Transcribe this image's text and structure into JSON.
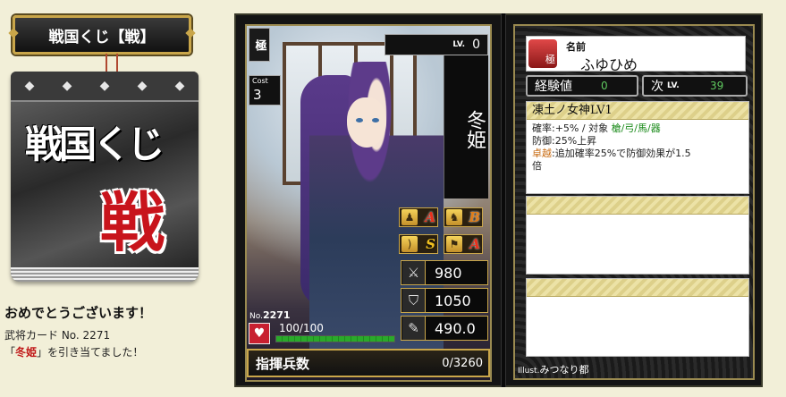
{
  "header": {
    "title": "戦国くじ【戦】"
  },
  "ticket": {
    "line1": "戦国くじ",
    "line2": "戦",
    "top_marks": [
      "◆",
      "◆",
      "◆",
      "◆",
      "◆"
    ]
  },
  "result": {
    "congrats": "おめでとうございます！",
    "card_line": "武将カード No. 2271",
    "hit_prefix": "「",
    "hit_name": "冬姫",
    "hit_suffix": "」を引き当てました！"
  },
  "card": {
    "rank": "極",
    "cost_label": "Cost",
    "cost": "3",
    "level_label": "LV.",
    "level": "0",
    "name_vertical": "冬姫",
    "number_label": "No.",
    "number": "2271",
    "hp_text": "100/100",
    "hp_fraction": 1.0,
    "aptitudes": [
      {
        "icon": "spear-icon",
        "symbol": "♟",
        "grade": "A",
        "grade_class": "grade-A"
      },
      {
        "icon": "horse-icon",
        "symbol": "♞",
        "grade": "B",
        "grade_class": "grade-B"
      },
      {
        "icon": "bow-icon",
        "symbol": ")",
        "grade": "S",
        "grade_class": "grade-S"
      },
      {
        "icon": "cannon-icon",
        "symbol": "⚑",
        "grade": "A",
        "grade_class": "grade-A"
      }
    ],
    "stats": [
      {
        "icon": "attack-icon",
        "symbol": "⚔",
        "value": "980"
      },
      {
        "icon": "defense-icon",
        "symbol": "⛉",
        "value": "1050"
      },
      {
        "icon": "strategy-icon",
        "symbol": "✎",
        "value": "490.0"
      }
    ],
    "troops_label": "指揮兵数",
    "troops_value": "0/3260"
  },
  "info": {
    "name_label": "名前",
    "name_value": "ふゆひめ",
    "name_icon_text": "極",
    "exp_label": "経験値",
    "exp_value": "0",
    "next_label": "次",
    "next_lv_label": "LV.",
    "next_value": "39",
    "skill": {
      "title": "凍土ノ女神LV1",
      "line1_a": "確率:+5%  /  対象  ",
      "line1_b": "槍/弓/馬/器",
      "line2": "防御:25%上昇",
      "line3_a": "卓越",
      "line3_b": ":追加確率25%で防御効果が1.5",
      "line4": "倍"
    },
    "illust_label": "Illust.",
    "illust_value": "みつなり都"
  }
}
